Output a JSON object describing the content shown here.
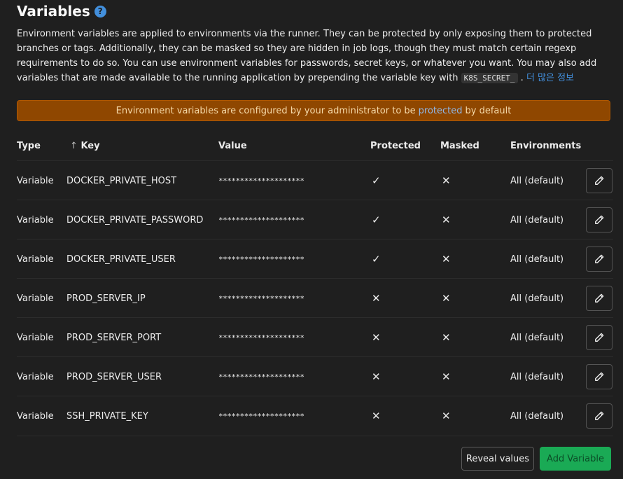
{
  "header": {
    "title": "Variables",
    "help_icon": "?",
    "desc_text": "Environment variables are applied to environments via the runner. They can be protected by only exposing them to protected branches or tags. Additionally, they can be masked so they are hidden in job logs, though they must match certain regexp requirements to do so. You can use environment variables for passwords, secret keys, or whatever you want. You may also add variables that are made available to the running application by prepending the variable key with",
    "desc_code": "K8S_SECRET_",
    "desc_after": ".",
    "more_link": "더 많은 정보"
  },
  "banner": {
    "before": "Environment variables are configured by your administrator to be",
    "highlight": "protected",
    "after": "by default"
  },
  "table": {
    "headers": {
      "type": "Type",
      "sort_arrow": "↑",
      "key": "Key",
      "value": "Value",
      "protected": "Protected",
      "masked": "Masked",
      "environments": "Environments"
    },
    "rows": [
      {
        "type": "Variable",
        "key": "DOCKER_PRIVATE_HOST",
        "value": "********************",
        "protected": "✓",
        "masked": "✕",
        "env": "All (default)"
      },
      {
        "type": "Variable",
        "key": "DOCKER_PRIVATE_PASSWORD",
        "value": "********************",
        "protected": "✓",
        "masked": "✕",
        "env": "All (default)"
      },
      {
        "type": "Variable",
        "key": "DOCKER_PRIVATE_USER",
        "value": "********************",
        "protected": "✓",
        "masked": "✕",
        "env": "All (default)"
      },
      {
        "type": "Variable",
        "key": "PROD_SERVER_IP",
        "value": "********************",
        "protected": "✕",
        "masked": "✕",
        "env": "All (default)"
      },
      {
        "type": "Variable",
        "key": "PROD_SERVER_PORT",
        "value": "********************",
        "protected": "✕",
        "masked": "✕",
        "env": "All (default)"
      },
      {
        "type": "Variable",
        "key": "PROD_SERVER_USER",
        "value": "********************",
        "protected": "✕",
        "masked": "✕",
        "env": "All (default)"
      },
      {
        "type": "Variable",
        "key": "SSH_PRIVATE_KEY",
        "value": "********************",
        "protected": "✕",
        "masked": "✕",
        "env": "All (default)"
      }
    ],
    "edit_icon": "pencil-icon"
  },
  "actions": {
    "reveal_label": "Reveal values",
    "add_label": "Add Variable"
  },
  "colors": {
    "background": "#1f1f1f",
    "banner": "#8f4700",
    "link": "#428fdc",
    "add_button": "#1aaa55"
  }
}
